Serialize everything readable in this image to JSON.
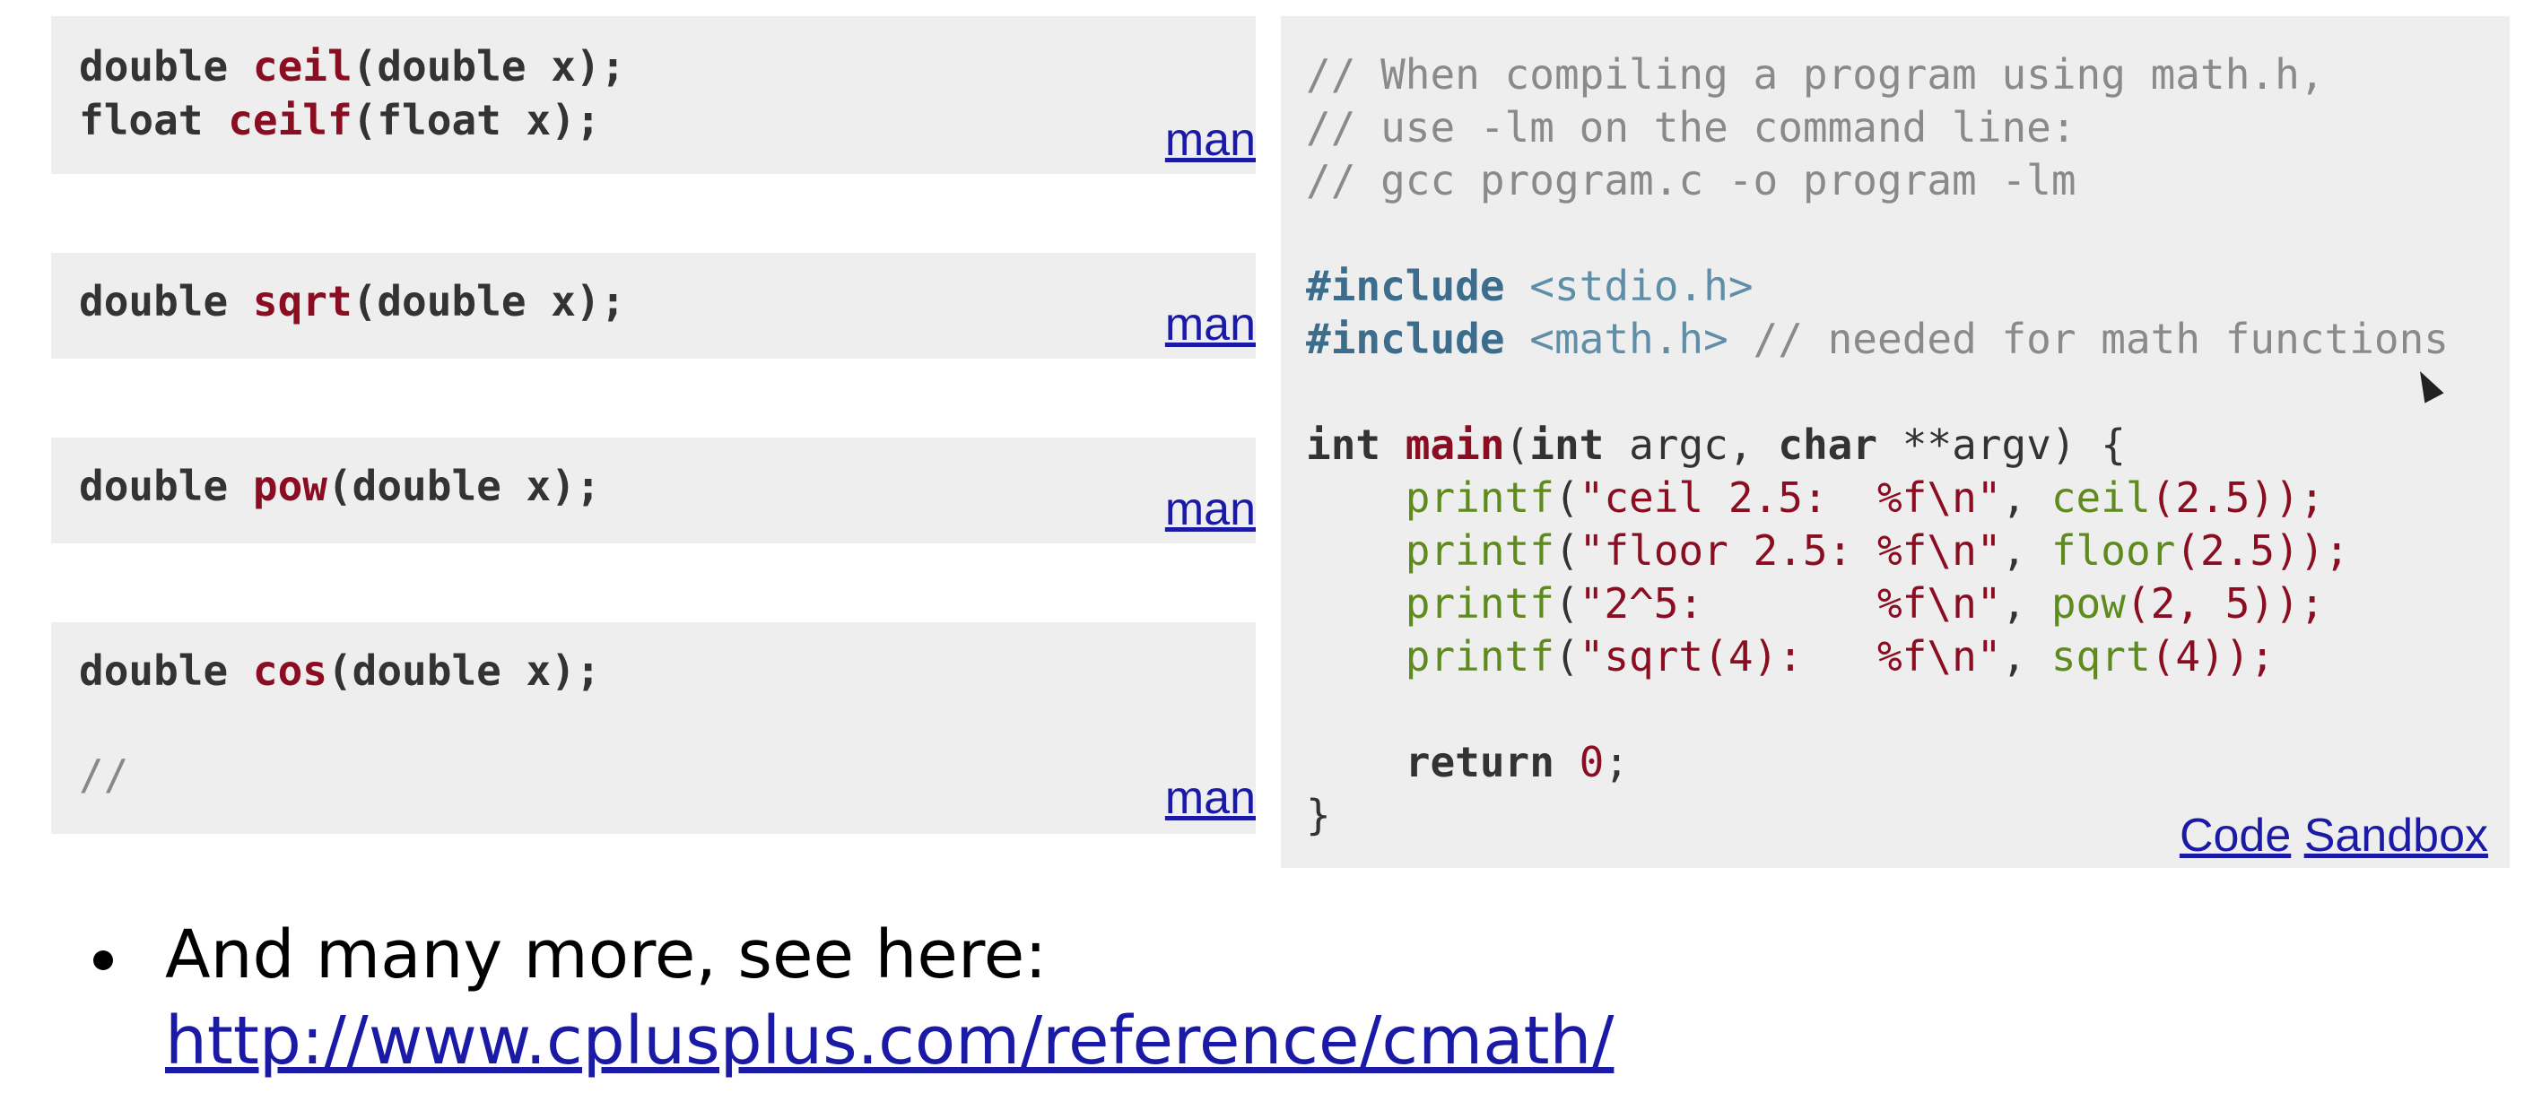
{
  "functions": [
    {
      "lines": [
        {
          "ret": "double",
          "name": "ceil",
          "args": "(double x);"
        },
        {
          "ret": "float",
          "name": "ceilf",
          "args": "(float x);"
        }
      ],
      "link": "man"
    },
    {
      "lines": [
        {
          "ret": "double",
          "name": "sqrt",
          "args": "(double x);"
        }
      ],
      "link": "man"
    },
    {
      "lines": [
        {
          "ret": "double",
          "name": "pow",
          "args": "(double x);"
        }
      ],
      "link": "man"
    },
    {
      "lines": [
        {
          "ret": "double",
          "name": "cos",
          "args": "(double x);"
        }
      ],
      "comment": "//",
      "link": "man"
    }
  ],
  "code": {
    "comment1": "// When compiling a program using math.h,",
    "comment2": "// use -lm on the command line:",
    "comment3": "// gcc program.c -o program -lm",
    "include_kw": "#include",
    "header1": "<stdio.h>",
    "header2": "<math.h>",
    "include_comment": "// needed for math functions",
    "main_type": "int",
    "main_name": "main",
    "main_args_1": "(",
    "main_args_type1": "int",
    "main_args_2": " argc, ",
    "main_args_type2": "char",
    "main_args_3": " **argv) {",
    "printf": "printf",
    "s1": "\"ceil 2.5:  %f\\n\"",
    "c1": "ceil",
    "a1": "(2.5));",
    "s2": "\"floor 2.5: %f\\n\"",
    "c2": "floor",
    "a2": "(2.5));",
    "s3": "\"2^5:       %f\\n\"",
    "c3": "pow",
    "a3": "(2, 5));",
    "s4": "\"sqrt(4):   %f\\n\"",
    "c4": "sqrt",
    "a4": "(4));",
    "return_kw": "return",
    "return_val": "0",
    "close": "}"
  },
  "code_links": {
    "code": "Code",
    "sandbox": "Sandbox"
  },
  "bullet": {
    "text": "And many more, see here:",
    "url": "http://www.cplusplus.com/reference/cmath/"
  }
}
